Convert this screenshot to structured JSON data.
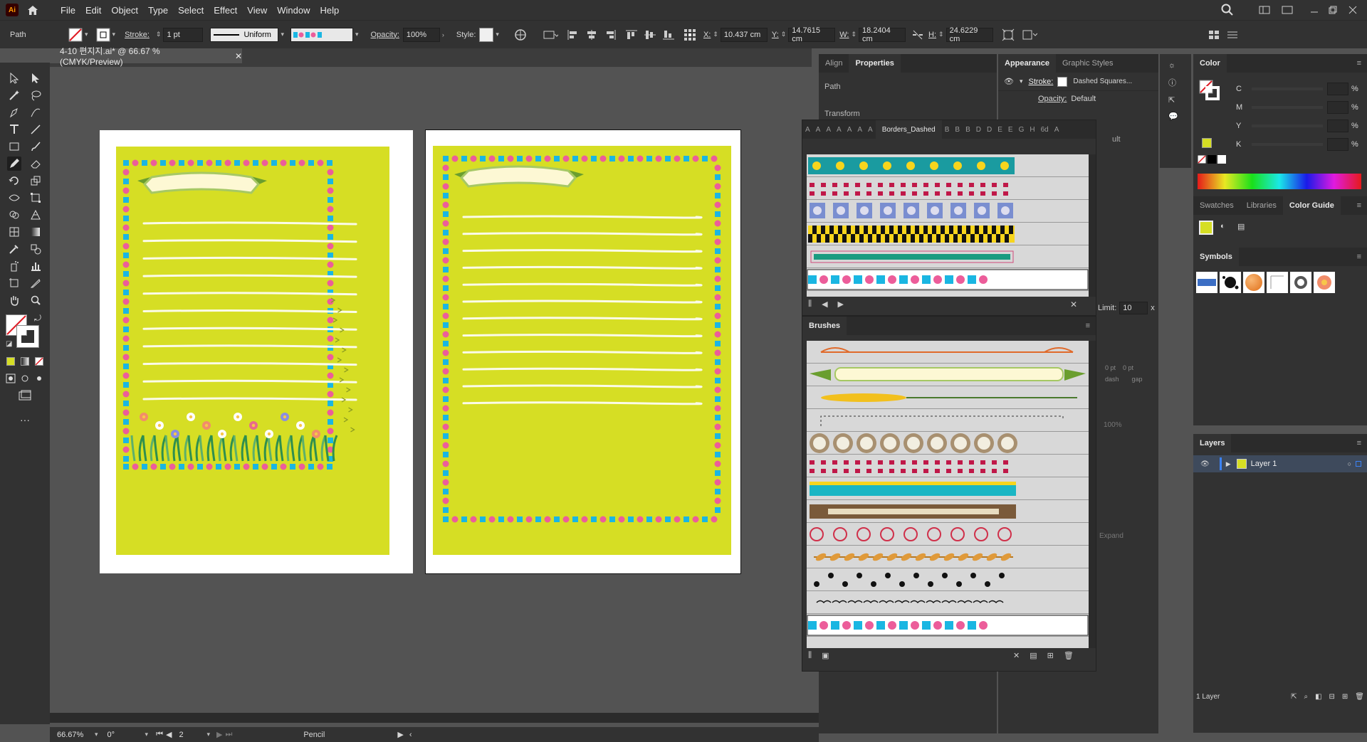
{
  "app": {
    "logo": "Ai"
  },
  "menu": [
    "File",
    "Edit",
    "Object",
    "Type",
    "Select",
    "Effect",
    "View",
    "Window",
    "Help"
  ],
  "control": {
    "selection": "Path",
    "stroke_label": "Stroke:",
    "stroke_weight": "1 pt",
    "stroke_profile": "Uniform",
    "opacity_label": "Opacity:",
    "opacity": "100%",
    "style_label": "Style:",
    "x_label": "X:",
    "x": "10.437 cm",
    "y_label": "Y:",
    "y": "14.7615 cm",
    "w_label": "W:",
    "w": "18.2404 cm",
    "h_label": "H:",
    "h": "24.6229 cm"
  },
  "document": {
    "tab_title": "4-10 편지지.ai* @ 66.67 % (CMYK/Preview)"
  },
  "status": {
    "zoom": "66.67%",
    "rotate": "0°",
    "artboard": "2",
    "tool": "Pencil"
  },
  "colors": {
    "paper": "#d6de24",
    "cyan": "#1ab6e2",
    "pink": "#ec5d9a",
    "fill_swatch": "#d6de24"
  },
  "properties_panel": {
    "tabs": [
      "Align",
      "Properties"
    ],
    "section1": "Path",
    "section2": "Transform"
  },
  "appearance_panel": {
    "tabs": [
      "Appearance",
      "Graphic Styles"
    ],
    "stroke_label": "Stroke:",
    "stroke_value": "Dashed Squares...",
    "opacity_label": "Opacity:",
    "opacity_value": "Default",
    "partial": "ult",
    "limit_label": "Limit:",
    "limit_value": "10",
    "limit_unit": "x",
    "expand_label": "Expand",
    "dash_label": "dash",
    "gap_label": "gap",
    "pt1": "0 pt",
    "pt2": "0 pt",
    "pct": "100%"
  },
  "borders_library": {
    "prefix_tabs": [
      "A",
      "A",
      "A",
      "A",
      "A",
      "A",
      "A"
    ],
    "active_tab": "Borders_Dashed",
    "suffix_tabs": [
      "B",
      "B",
      "B",
      "D",
      "D",
      "E",
      "E",
      "G",
      "H",
      "6d",
      "A"
    ]
  },
  "brushes_panel": {
    "title": "Brushes"
  },
  "color_panel": {
    "title": "Color",
    "channels": [
      {
        "label": "C",
        "unit": "%"
      },
      {
        "label": "M",
        "unit": "%"
      },
      {
        "label": "Y",
        "unit": "%"
      },
      {
        "label": "K",
        "unit": "%"
      }
    ]
  },
  "guide_tabs": [
    "Swatches",
    "Libraries",
    "Color Guide"
  ],
  "symbols_panel": {
    "title": "Symbols"
  },
  "layers_panel": {
    "title": "Layers",
    "layer_name": "Layer 1",
    "count": "1 Layer"
  }
}
